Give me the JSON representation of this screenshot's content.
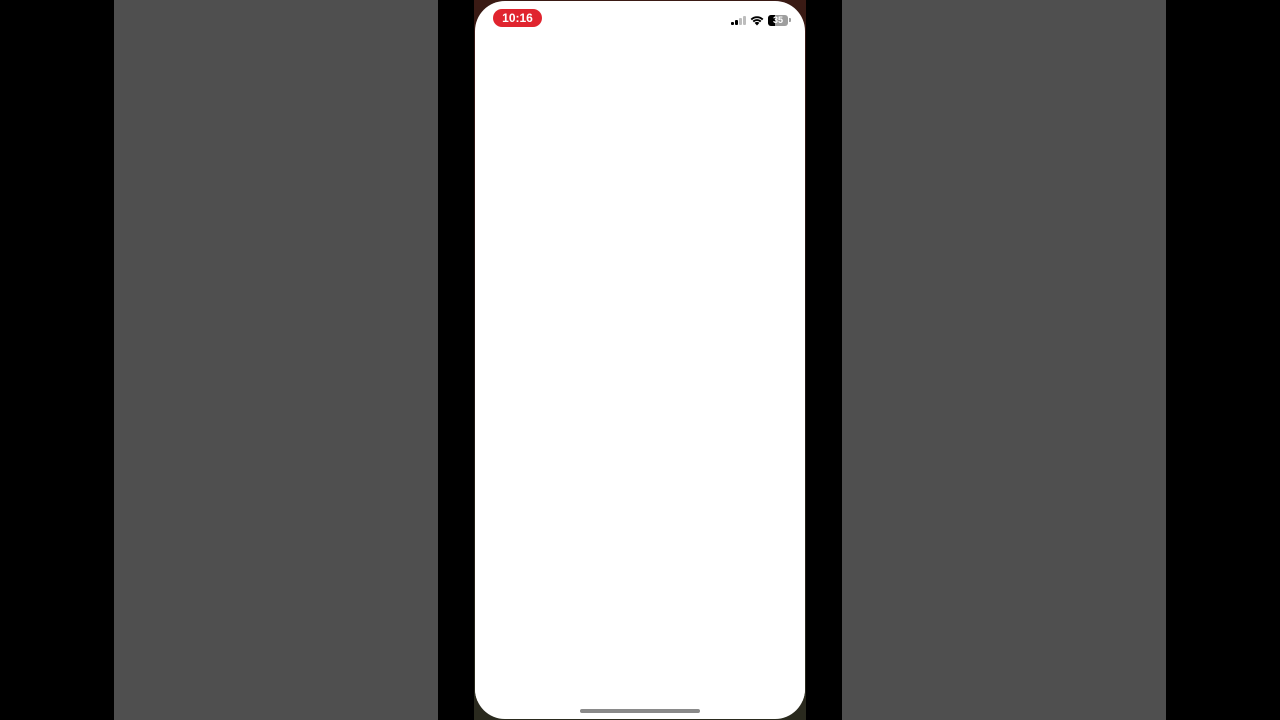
{
  "status_bar": {
    "time": "10:16",
    "battery_percent": 35,
    "battery_label": "35",
    "signal_bars_active": 2,
    "signal_bars_total": 4,
    "icons": [
      "signal-icon",
      "wifi-icon",
      "battery-icon"
    ]
  },
  "colors": {
    "time_pill": "#e0242e",
    "screen_background": "#ffffff",
    "side_panels": "#4f4f4f",
    "outer_background": "#000000"
  }
}
